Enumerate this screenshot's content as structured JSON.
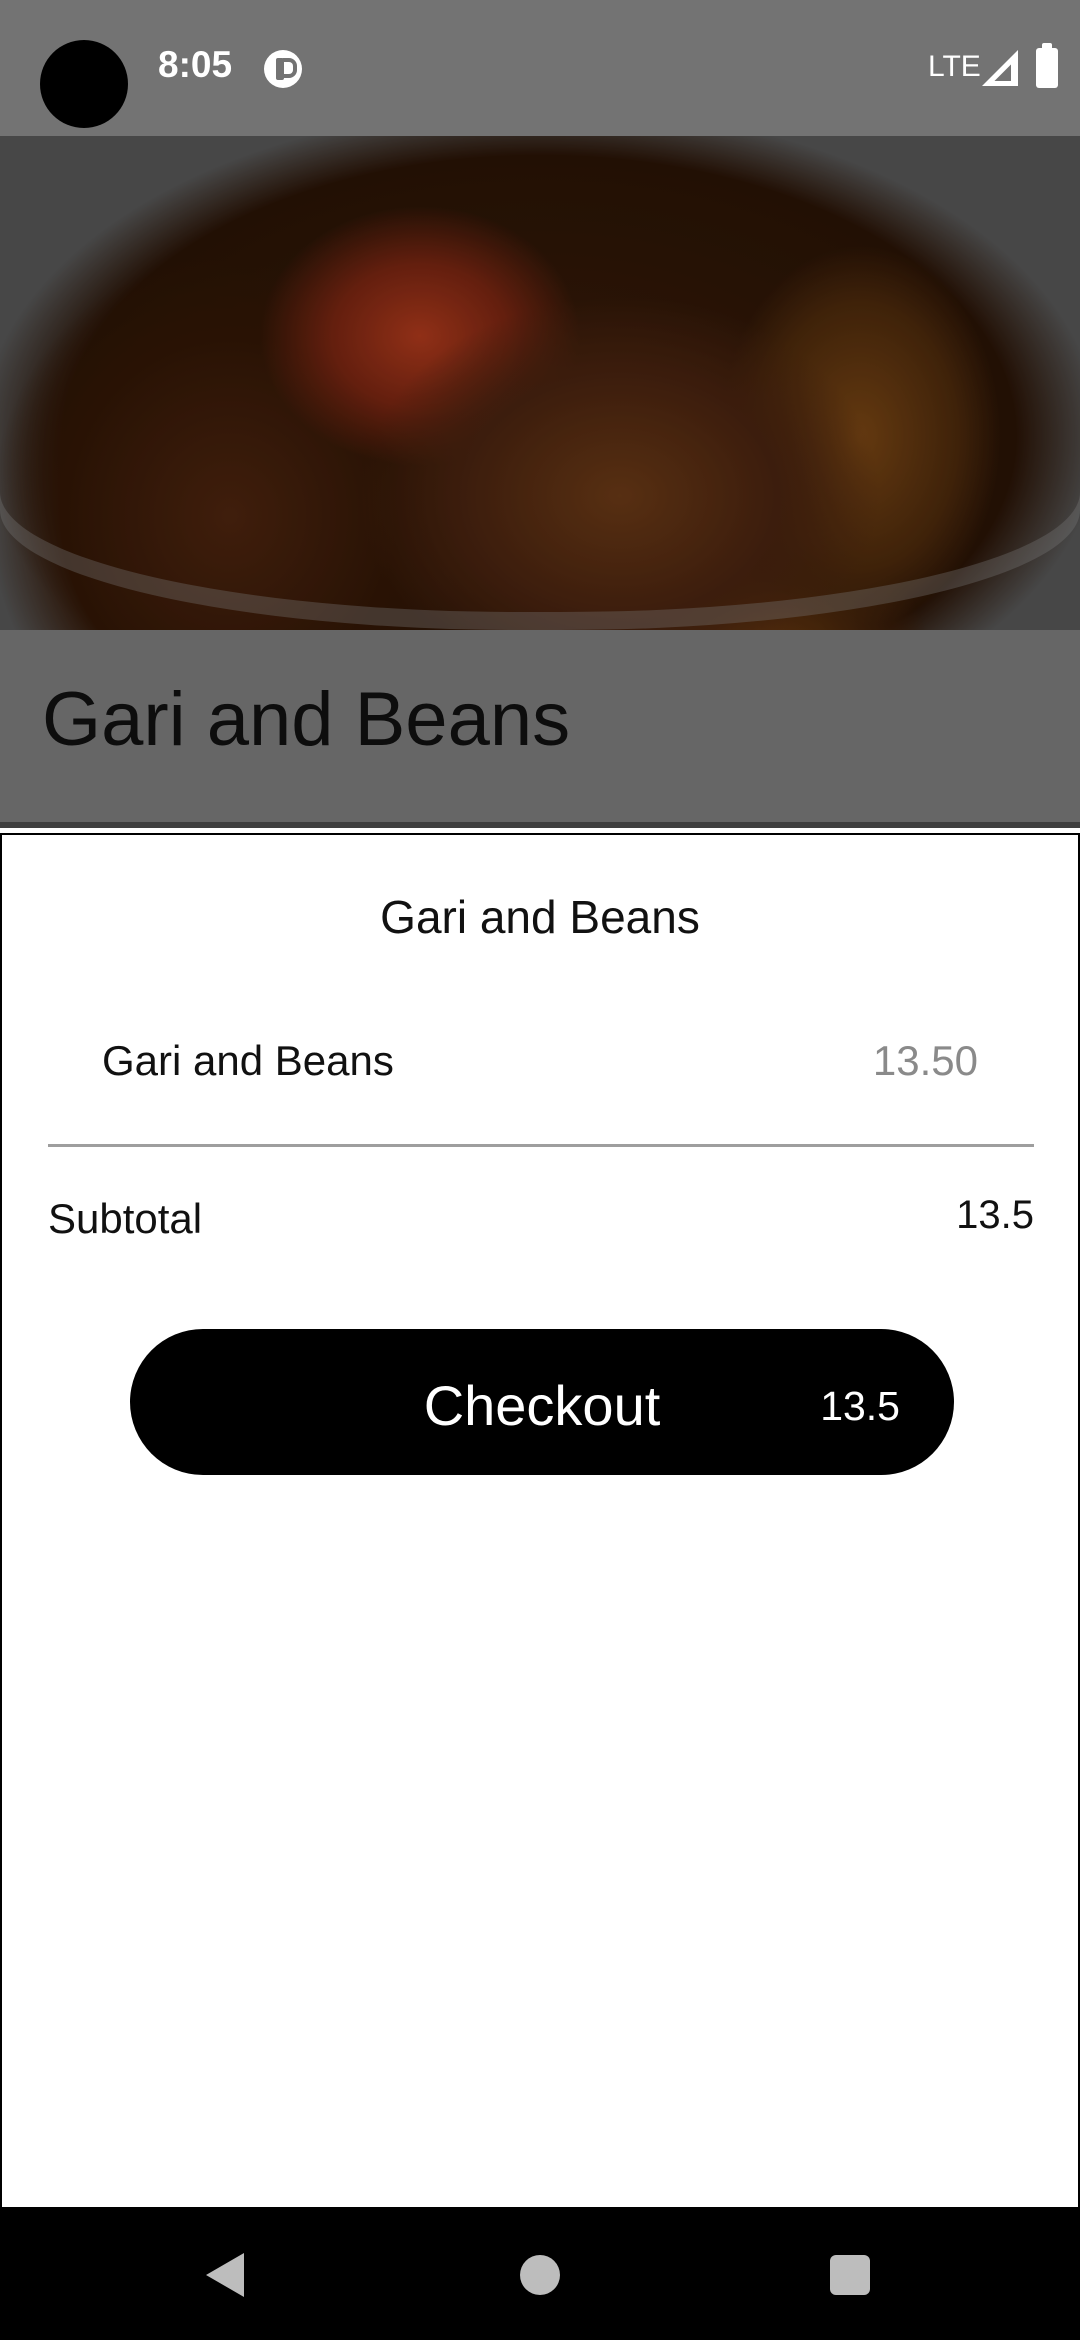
{
  "status_bar": {
    "time": "8:05",
    "network": "LTE",
    "app_icon": "pocket-casts-like-icon",
    "signal_icon": "signal-icon",
    "battery_icon": "battery-icon"
  },
  "background_page": {
    "title": "Gari and Beans",
    "hero_image": "gari-and-beans-dish-photo"
  },
  "sheet": {
    "title": "Gari and Beans",
    "items": [
      {
        "name": "Gari and Beans",
        "price": "13.50"
      }
    ],
    "subtotal_label": "Subtotal",
    "subtotal_value": "13.5",
    "checkout": {
      "label": "Checkout",
      "amount": "13.5"
    }
  },
  "nav_bar": {
    "back_icon": "back-icon",
    "home_icon": "home-icon",
    "recents_icon": "recents-icon"
  },
  "colors": {
    "status_bar": "#737373",
    "scrim_band": "#666666",
    "button": "#000000",
    "price_muted": "#8a8a8a"
  }
}
